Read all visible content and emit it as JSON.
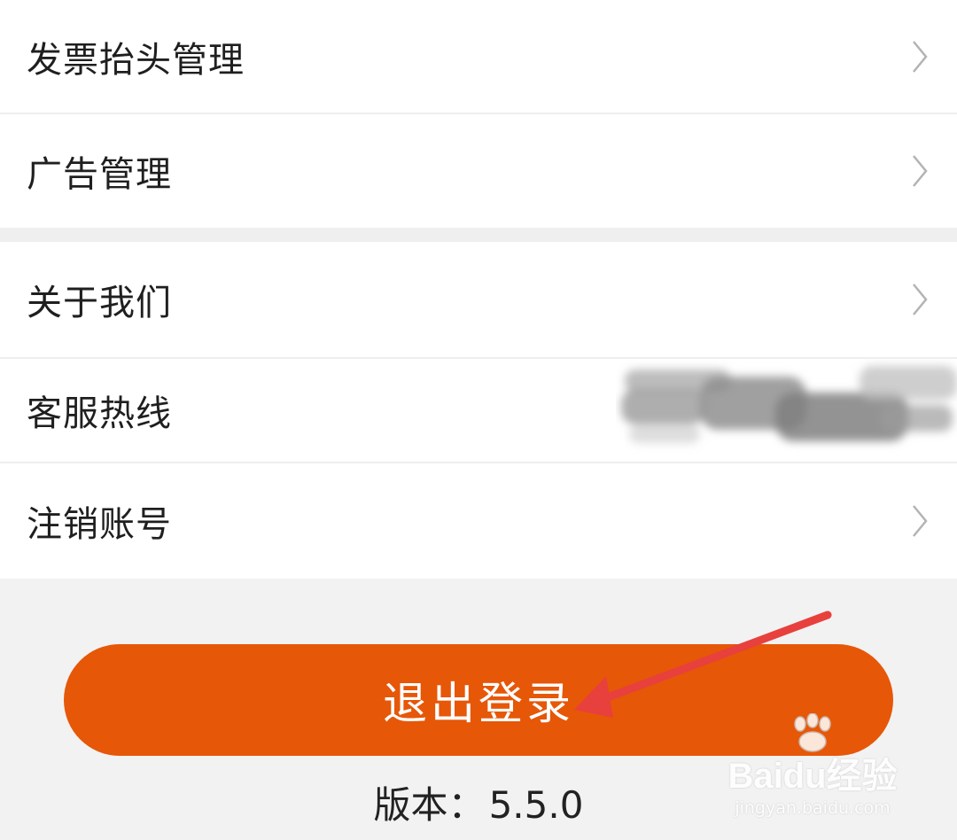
{
  "menu_group_1": [
    {
      "label": "发票抬头管理",
      "has_arrow": true
    },
    {
      "label": "广告管理",
      "has_arrow": true
    }
  ],
  "menu_group_2": [
    {
      "label": "关于我们",
      "has_arrow": true
    },
    {
      "label": "客服热线",
      "has_arrow": false,
      "value_redacted": true
    },
    {
      "label": "注销账号",
      "has_arrow": true
    }
  ],
  "logout_button": {
    "label": "退出登录"
  },
  "version": {
    "prefix": "版本：",
    "number": "5.5.0"
  },
  "watermark": {
    "brand": "Baidu经验",
    "url": "jingyan.baidu.com"
  },
  "colors": {
    "accent": "#e65708",
    "arrow_annotation": "#e8403c"
  },
  "icons": {
    "row_arrow": "chevron-right-icon",
    "annotation": "red-arrow-icon",
    "watermark": "paw-icon"
  }
}
